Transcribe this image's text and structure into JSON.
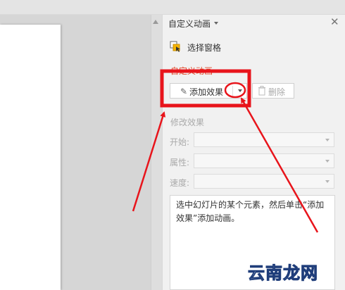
{
  "panel": {
    "title": "自定义动画",
    "close_glyph": "✕",
    "select_pane_label": "选择窗格",
    "custom_anim_header": "自定义动画",
    "add_effect_label": "添加效果",
    "delete_label": "删除",
    "modify_header": "修改效果",
    "start_label": "开始:",
    "property_label": "属性:",
    "speed_label": "速度:",
    "hint_text": "选中幻灯片的某个元素，然后单击“添加效果”添加动画。"
  },
  "watermark_text": "云南龙网",
  "colors": {
    "annotation_red": "#e8141b",
    "section_red": "#e24a2a",
    "panel_bg": "#f1f1f1"
  },
  "icons": {
    "select_pane": "select-pane-icon",
    "add_effect": "pencil-icon",
    "delete": "trash-icon",
    "dropdown": "chevron-down-icon",
    "close": "close-icon"
  }
}
